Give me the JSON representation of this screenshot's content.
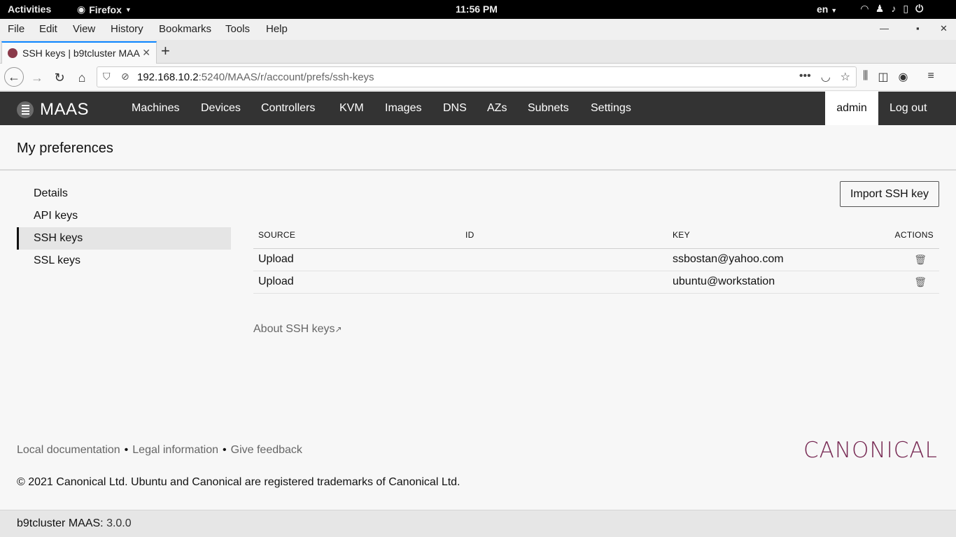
{
  "gnome": {
    "activities": "Activities",
    "app": "Firefox",
    "clock": "11:56 PM",
    "lang": "en",
    "tray_icons": [
      "wifi-icon",
      "notification-icon",
      "volume-icon",
      "battery-icon",
      "power-icon"
    ]
  },
  "menubar": {
    "items": [
      "File",
      "Edit",
      "View",
      "History",
      "Bookmarks",
      "Tools",
      "Help"
    ]
  },
  "tabs": {
    "active_title": "SSH keys | b9tcluster MAAS",
    "close": "✕",
    "new_tab": "+"
  },
  "urlbar": {
    "host": "192.168.10.2",
    "rest": ":5240/MAAS/r/account/prefs/ssh-keys"
  },
  "maas": {
    "brand": "MAAS",
    "nav": [
      "Machines",
      "Devices",
      "Controllers",
      "KVM",
      "Images",
      "DNS",
      "AZs",
      "Subnets",
      "Settings"
    ],
    "user": "admin",
    "logout": "Log out"
  },
  "page": {
    "title": "My preferences"
  },
  "sidebar": {
    "items": [
      {
        "label": "Details"
      },
      {
        "label": "API keys"
      },
      {
        "label": "SSH keys"
      },
      {
        "label": "SSL keys"
      }
    ],
    "active_index": 2
  },
  "content": {
    "import_button": "Import SSH key",
    "columns": [
      "SOURCE",
      "ID",
      "KEY",
      "ACTIONS"
    ],
    "rows": [
      {
        "source": "Upload",
        "id": "",
        "key": "ssbostan@yahoo.com"
      },
      {
        "source": "Upload",
        "id": "",
        "key": "ubuntu@workstation"
      }
    ],
    "about_link": "About SSH keys"
  },
  "footer": {
    "links": [
      "Local documentation",
      "Legal information",
      "Give feedback"
    ],
    "separator": "•",
    "logo": "CANONICAL",
    "copyright": "© 2021 Canonical Ltd. Ubuntu and Canonical are registered trademarks of Canonical Ltd.",
    "cluster": "b9tcluster MAAS:",
    "version": "3.0.0"
  },
  "colors": {
    "maas_nav_bg": "#333333",
    "canonical_aubergine": "#772953",
    "firefox_accent": "#0a84ff"
  }
}
